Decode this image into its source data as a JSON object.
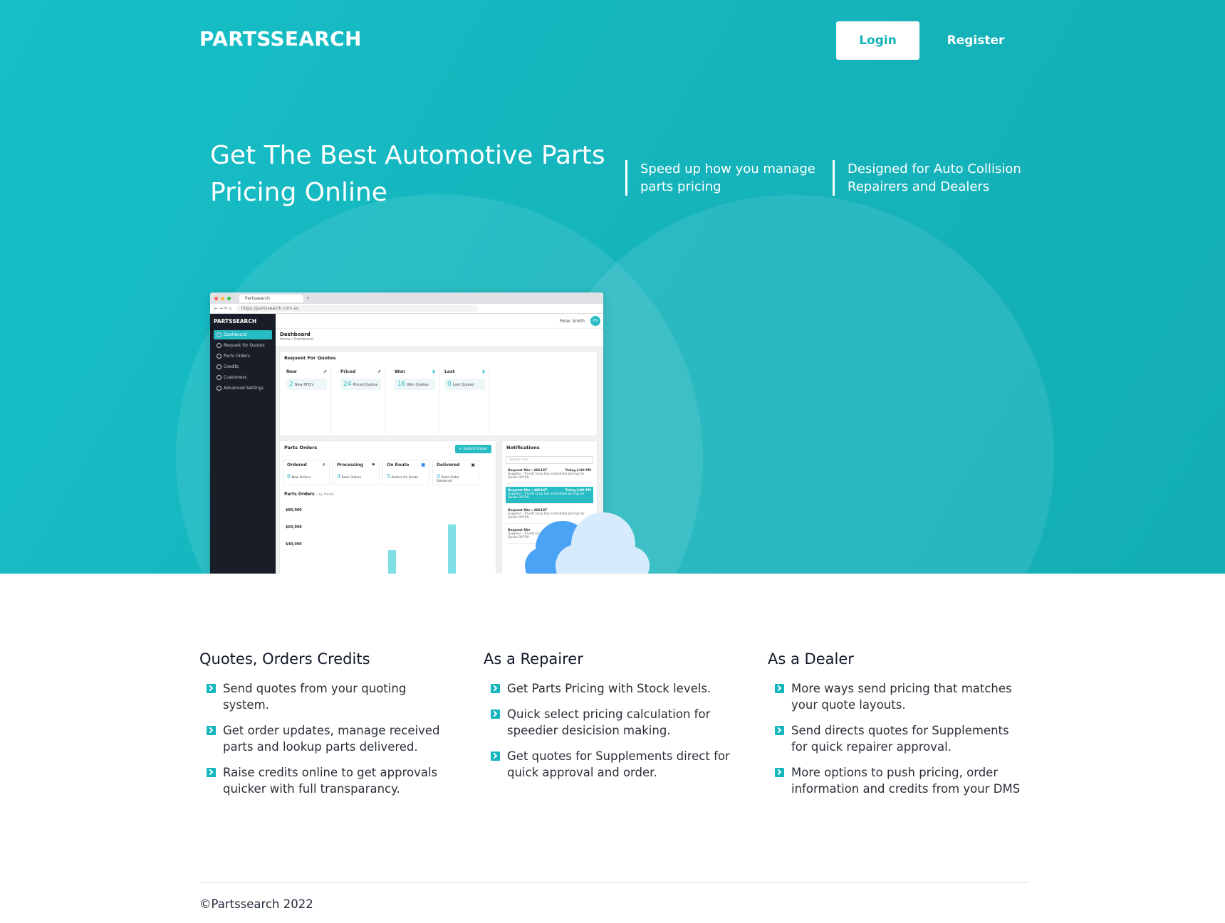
{
  "brand": "PARTSSEARCH",
  "nav": {
    "login": "Login",
    "register": "Register"
  },
  "hero": {
    "headline": "Get The Best Automotive Parts Pricing Online",
    "features": [
      "Speed up how you manage parts pricing",
      "Designed for Auto Collision Repairers and Dealers"
    ]
  },
  "mockup": {
    "tab_title": "Partssearch",
    "url": "https://partssearch.com.au",
    "sidebar_brand": "PARTSSEARCH",
    "sidebar": [
      "Dashboard",
      "Request for Quotes",
      "Parts Orders",
      "Credits",
      "Customers",
      "Advanced Settings"
    ],
    "user": "Peter Smith",
    "user_initials": "PS",
    "page_title": "Dashboard",
    "breadcrumb": "Home / Dashboard",
    "rfq_title": "Request For Quotes",
    "rfq_stats": [
      {
        "label": "New",
        "count": "2",
        "desc": "New RFQ's"
      },
      {
        "label": "Priced",
        "count": "24",
        "desc": "Priced Quotes"
      },
      {
        "label": "Won",
        "count": "16",
        "desc": "Won Quotes"
      },
      {
        "label": "Lost",
        "count": "0",
        "desc": "Lost Quotes"
      }
    ],
    "po_title": "Parts Orders",
    "submit_order": "+ Submit Order",
    "po_stats": [
      {
        "label": "Ordered",
        "count": "6",
        "desc": "New Orders"
      },
      {
        "label": "Processing",
        "count": "4",
        "desc": "Back Orders"
      },
      {
        "label": "On Route",
        "count": "5",
        "desc": "Orders On Route"
      },
      {
        "label": "Delivered",
        "count": "4",
        "desc": "Parts Order Delivered"
      }
    ],
    "chart_title": "Parts Orders",
    "chart_sub": "• by Month",
    "chart_axis": [
      "$80,000",
      "$60,000",
      "$40,000"
    ],
    "notif_title": "Notifications",
    "notif_search": "Search here",
    "notifications": [
      {
        "head": "Request Nbr : 4961ST",
        "time": "Today,2:00 PM",
        "body": "Supplier - Trivett Gray has submitted pricing for Quote 00799"
      },
      {
        "head": "Request Nbr : 4961ST",
        "time": "Today,2:00 PM",
        "body": "Supplier - Trivett Gray has submitted pricing for Quote 00799"
      },
      {
        "head": "Request Nbr : 4961ST",
        "time": "",
        "body": "Supplier - Trivett Gray has submitted pricing for Quote 00799"
      },
      {
        "head": "Request Nbr",
        "time": "",
        "body": "Supplier - Trivett Gray has submitted pricing for Quote 00799"
      }
    ]
  },
  "columns": [
    {
      "title": "Quotes, Orders Credits",
      "items": [
        "Send quotes from your quoting system.",
        "Get order updates, manage received parts and lookup parts delivered.",
        "Raise credits online to get approvals quicker with full transparancy."
      ]
    },
    {
      "title": "As a Repairer",
      "items": [
        "Get Parts Pricing with Stock levels.",
        "Quick select pricing calculation for speedier desicision making.",
        "Get quotes for Supplements direct for quick approval and order."
      ]
    },
    {
      "title": "As a Dealer",
      "items": [
        "More ways send pricing that matches your quote layouts.",
        "Send directs quotes for Supplements for quick repairer approval.",
        "More options to push pricing, order information and credits from your DMS"
      ]
    }
  ],
  "footer": {
    "copyright": "©Partssearch 2022"
  },
  "colors": {
    "accent": "#16b6be",
    "hero_bg": "#15b3bb"
  }
}
